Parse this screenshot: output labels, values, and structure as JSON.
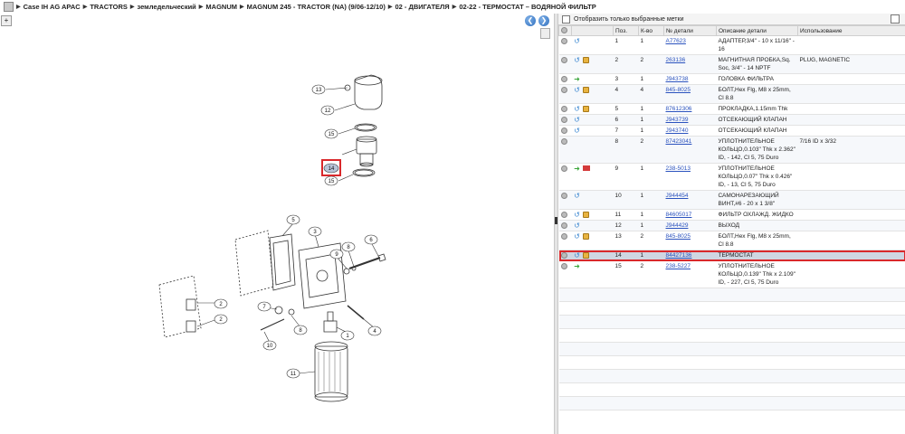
{
  "breadcrumb": [
    "Case IH AG APAC",
    "TRACTORS",
    "земледельческий",
    "MAGNUM",
    "MAGNUM 245 - TRACTOR (NA) (9/06-12/10)",
    "02 - ДВИГАТЕЛЯ",
    "02-22 - ТЕРМОСТАТ – ВОДЯНОЙ ФИЛЬТР"
  ],
  "filter": {
    "label": "Отобразить только выбранные метки"
  },
  "columns": {
    "pos": "Поз.",
    "qty": "К-во",
    "part": "№ детали",
    "desc": "Описание детали",
    "usage": "Использование"
  },
  "rows": [
    {
      "pos": "1",
      "qty": "1",
      "part": "A77623",
      "desc": "АДАПТЕР,3/4\" - 10 x 11/16\" - 16",
      "usage": "",
      "icons": "arrow"
    },
    {
      "pos": "2",
      "qty": "2",
      "part": "263136",
      "desc": "МАГНИТНАЯ ПРОБКА,Sq. Soc, 3/4\" - 14 NPTF",
      "usage": "PLUG, MAGNETIC",
      "icons": "arrow-box"
    },
    {
      "pos": "3",
      "qty": "1",
      "part": "J943738",
      "desc": "ГОЛОВКА ФИЛЬТРА",
      "usage": "",
      "icons": "green"
    },
    {
      "pos": "4",
      "qty": "4",
      "part": "845-8025",
      "desc": "БОЛТ,Hex Flg, M8 x 25mm, Cl 8.8",
      "usage": "",
      "icons": "arrow-box"
    },
    {
      "pos": "5",
      "qty": "1",
      "part": "87612306",
      "desc": "ПРОКЛАДКА,1.15mm Thk",
      "usage": "",
      "icons": "arrow-box"
    },
    {
      "pos": "6",
      "qty": "1",
      "part": "J943739",
      "desc": "ОТСЕКАЮЩИЙ КЛАПАН",
      "usage": "",
      "icons": "arrow"
    },
    {
      "pos": "7",
      "qty": "1",
      "part": "J943740",
      "desc": "ОТСЕКАЮЩИЙ КЛАПАН",
      "usage": "",
      "icons": "arrow"
    },
    {
      "pos": "8",
      "qty": "2",
      "part": "87423041",
      "desc": "УПЛОТНИТЕЛЬНОЕ КОЛЬЦО,0.103\" Thk x 2.362\" ID, - 142, Cl 5, 75 Duro",
      "usage": "7/16 ID x 3/32",
      "icons": ""
    },
    {
      "pos": "9",
      "qty": "1",
      "part": "238-5013",
      "desc": "УПЛОТНИТЕЛЬНОЕ КОЛЬЦО,0.07\" Thk x 0.426\" ID, - 13, Cl 5, 75 Duro",
      "usage": "",
      "icons": "green-warn"
    },
    {
      "pos": "10",
      "qty": "1",
      "part": "J944454",
      "desc": "САМОНАРЕЗАЮЩИЙ ВИНТ,#6 - 20 x 1 3/8\"",
      "usage": "",
      "icons": "arrow"
    },
    {
      "pos": "11",
      "qty": "1",
      "part": "84605017",
      "desc": "ФИЛЬТР ОХЛАЖД. ЖИДКО",
      "usage": "",
      "icons": "arrow-box"
    },
    {
      "pos": "12",
      "qty": "1",
      "part": "J944429",
      "desc": "ВЫХОД",
      "usage": "",
      "icons": "arrow"
    },
    {
      "pos": "13",
      "qty": "2",
      "part": "845-8025",
      "desc": "БОЛТ,Hex Flg, M8 x 25mm, Cl 8.8",
      "usage": "",
      "icons": "arrow-box"
    },
    {
      "pos": "14",
      "qty": "1",
      "part": "84427136",
      "desc": "ТЕРМОСТАТ",
      "usage": "",
      "icons": "arrow-box",
      "selected": true
    },
    {
      "pos": "15",
      "qty": "2",
      "part": "238-5227",
      "desc": "УПЛОТНИТЕЛЬНОЕ КОЛЬЦО,0.139\" Thk x 2.109\" ID, - 227, Cl 5, 75 Duro",
      "usage": "",
      "icons": "green"
    }
  ],
  "callouts": [
    "13",
    "12",
    "15",
    "14",
    "15",
    "5",
    "3",
    "6",
    "9",
    "8",
    "2",
    "2",
    "7",
    "8",
    "1",
    "4",
    "10",
    "11"
  ],
  "colors": {
    "selected_row": "#cfd6e2",
    "highlight": "#d9282b",
    "link": "#2a52be"
  }
}
